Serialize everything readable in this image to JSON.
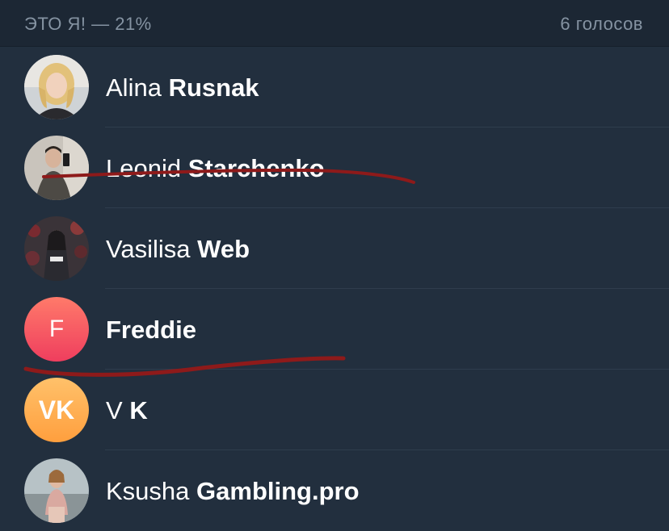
{
  "header": {
    "title": "ЭТО Я! — 21%",
    "votes": "6 голосов"
  },
  "voters": [
    {
      "first": "Alina",
      "last": "Rusnak",
      "avatar": "photo-blonde-woman"
    },
    {
      "first": "Leonid",
      "last": "Starchenko",
      "avatar": "photo-man-mirror-selfie"
    },
    {
      "first": "Vasilisa",
      "last": "Web",
      "avatar": "photo-woman-crowd"
    },
    {
      "first": "",
      "last": "Freddie",
      "avatar_letter": "F",
      "avatar_color": "#f0506a"
    },
    {
      "first": "V",
      "last": "K",
      "avatar_letter": "VK",
      "avatar_color": "#ffae4f"
    },
    {
      "first": "Ksusha",
      "last": "Gambling.pro",
      "avatar": "photo-woman-outdoors"
    }
  ],
  "colors": {
    "background": "#222f3e",
    "header_bg": "#1c2734",
    "strike": "#8e1a1a"
  }
}
